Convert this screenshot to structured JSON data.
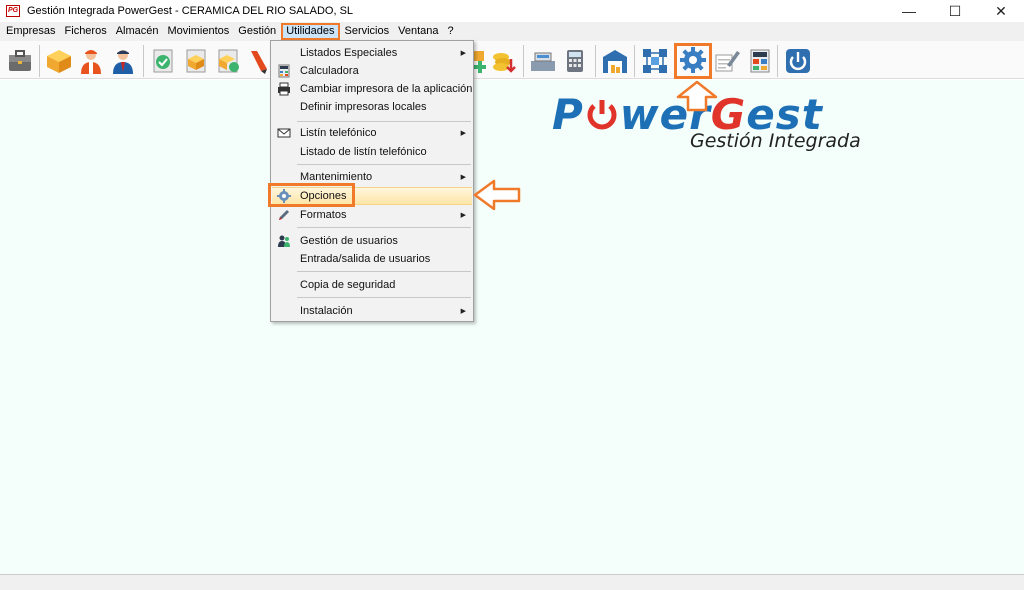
{
  "window": {
    "icon_text": "PG",
    "title": "Gestión Integrada PowerGest - CERAMICA DEL RIO SALADO, SL",
    "minimize": "—",
    "maximize": "☐",
    "close": "✕"
  },
  "menubar": {
    "items": [
      "Empresas",
      "Ficheros",
      "Almacén",
      "Movimientos",
      "Gestión",
      "Utilidades",
      "Servicios",
      "Ventana",
      "?"
    ],
    "active": "Utilidades"
  },
  "dropdown": {
    "items": [
      {
        "label": "Listados Especiales",
        "submenu": true,
        "icon": ""
      },
      {
        "label": "Calculadora",
        "submenu": false,
        "icon": "calculator-icon"
      },
      {
        "label": "Cambiar impresora de la aplicación",
        "submenu": false,
        "icon": "printer-icon"
      },
      {
        "label": "Definir impresoras locales",
        "submenu": false,
        "icon": ""
      },
      {
        "label": "Listín telefónico",
        "submenu": true,
        "icon": "envelope-icon"
      },
      {
        "label": "Listado de listín telefónico",
        "submenu": false,
        "icon": ""
      },
      {
        "label": "Mantenimiento",
        "submenu": true,
        "icon": ""
      },
      {
        "label": "Opciones",
        "submenu": false,
        "icon": "gear-icon",
        "highlighted": true
      },
      {
        "label": "Formatos",
        "submenu": true,
        "icon": "pencil-icon"
      },
      {
        "label": "Gestión de usuarios",
        "submenu": false,
        "icon": "users-icon"
      },
      {
        "label": "Entrada/salida de usuarios",
        "submenu": false,
        "icon": ""
      },
      {
        "label": "Copia de seguridad",
        "submenu": false,
        "icon": ""
      },
      {
        "label": "Instalación",
        "submenu": true,
        "icon": ""
      }
    ]
  },
  "logo": {
    "main_part1": "P",
    "main_part2": "wer",
    "main_part3": "G",
    "main_part4": "est",
    "sub": "Gestión Integrada"
  },
  "colors": {
    "accent_orange": "#f07a2a",
    "logo_blue": "#1d6fb6",
    "logo_red": "#e0342a",
    "workspace_bg": "#f4fffb"
  },
  "toolbar_icons": [
    "briefcase-icon",
    "box-icon",
    "worker-icon",
    "businessman-icon",
    "check-icon",
    "package-icon",
    "package-check-icon",
    "pen-icon",
    "add-icon",
    "coins-icon",
    "cash-register-icon",
    "calculator-device-icon",
    "warehouse-icon",
    "network-icon",
    "gear-icon",
    "edit-icon",
    "calculator-icon",
    "power-icon"
  ]
}
